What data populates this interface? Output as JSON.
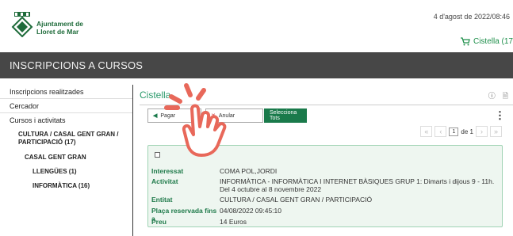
{
  "header": {
    "org_line1": "Ajuntament de",
    "org_line2": "Lloret de Mar",
    "date": "4 d'agost de 2022/08:46",
    "cart_label": "Cistella (17"
  },
  "title_bar": {
    "title": "INSCRIPCIONS A CURSOS"
  },
  "sidebar": {
    "items": [
      {
        "label": "Inscripcions realitzades"
      },
      {
        "label": "Cercador"
      },
      {
        "label": "Cursos i activitats"
      },
      {
        "label": "CULTURA / CASAL GENT GRAN / PARTICIPACIÓ (17)"
      },
      {
        "label": "CASAL GENT GRAN"
      },
      {
        "label": "LLENGÜES (1)"
      },
      {
        "label": "INFORMÀTICA (16)"
      }
    ]
  },
  "main": {
    "title": "Cistella",
    "buttons": {
      "pay": "Pagar",
      "cancel": "Anular",
      "select_all": "Selecciona Tots"
    },
    "pager": {
      "current": "1",
      "of": "de 1"
    },
    "record": {
      "fields": [
        {
          "label": "Interessat",
          "value": "COMA POL,JORDI"
        },
        {
          "label": "Activitat",
          "value": "INFORMÀTICA - INFORMÀTICA I INTERNET BÀSIQUES GRUP 1: Dimarts i dijous 9 - 11h. Del 4 octubre al 8 novembre 2022"
        },
        {
          "label": "Entitat",
          "value": "CULTURA / CASAL GENT GRAN / PARTICIPACIÓ"
        },
        {
          "label": "Plaça reservada fins a",
          "value": "04/08/2022 09:45:10"
        },
        {
          "label": "Preu",
          "value": "14 Euros"
        }
      ]
    }
  },
  "colors": {
    "accent_green": "#1a7a4b",
    "title_bar_bg": "#474747",
    "hand_color": "#e8685a"
  },
  "icons": [
    "logo-crest-icon",
    "cart-icon",
    "info-icon",
    "document-icon",
    "kebab-menu-icon",
    "pay-icon",
    "cancel-icon",
    "first-page-icon",
    "prev-page-icon",
    "next-page-icon",
    "last-page-icon",
    "click-hand-icon"
  ]
}
